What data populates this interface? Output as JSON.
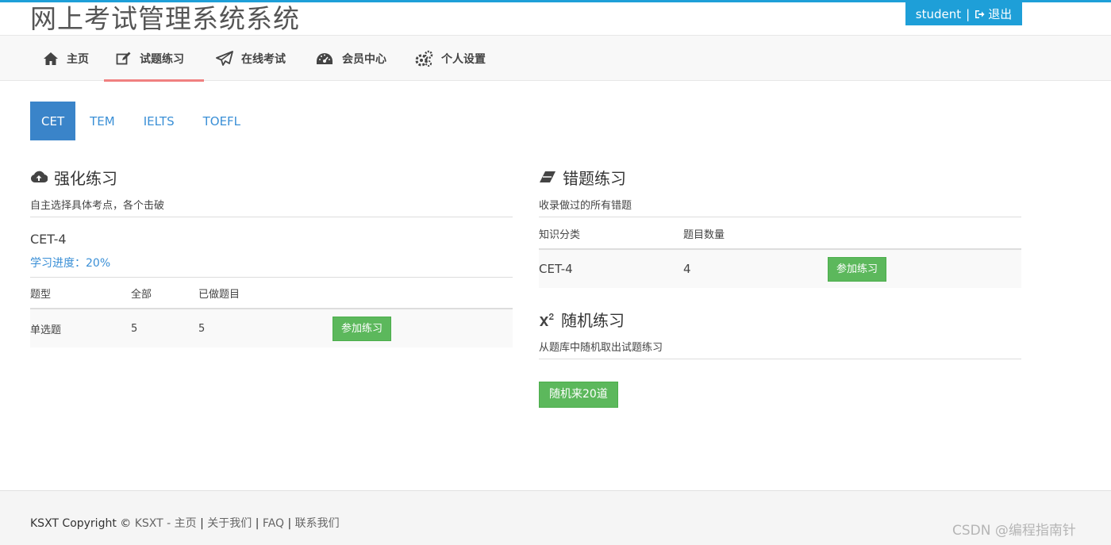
{
  "header": {
    "site_title": "网上考试管理系统系统",
    "username": "student",
    "separator": "|",
    "logout_label": "退出"
  },
  "nav": {
    "items": [
      {
        "label": "主页",
        "icon": "home-icon"
      },
      {
        "label": "试题练习",
        "icon": "edit-icon",
        "active": true
      },
      {
        "label": "在线考试",
        "icon": "paper-plane-icon"
      },
      {
        "label": "会员中心",
        "icon": "dashboard-icon"
      },
      {
        "label": "个人设置",
        "icon": "gears-icon"
      }
    ]
  },
  "tabs": [
    {
      "label": "CET",
      "active": true
    },
    {
      "label": "TEM"
    },
    {
      "label": "IELTS"
    },
    {
      "label": "TOEFL"
    }
  ],
  "intensive": {
    "title": "强化练习",
    "icon": "cloud-upload-icon",
    "desc": "自主选择具体考点，各个击破",
    "subject": "CET-4",
    "progress": "学习进度：20%",
    "progress_value": 0.2,
    "table": {
      "headers": [
        "题型",
        "全部",
        "已做题目",
        ""
      ],
      "rows": [
        {
          "type": "单选题",
          "total": "5",
          "done": "5",
          "action": "参加练习"
        }
      ]
    }
  },
  "wrong": {
    "title": "错题练习",
    "icon": "eraser-icon",
    "desc": "收录做过的所有错题",
    "table": {
      "headers": [
        "知识分类",
        "题目数量",
        ""
      ],
      "rows": [
        {
          "category": "CET-4",
          "count": "4",
          "action": "参加练习"
        }
      ]
    }
  },
  "random": {
    "title": "随机练习",
    "icon": "superscript-icon",
    "desc": "从题库中随机取出试题练习",
    "button": "随机来20道"
  },
  "footer": {
    "prefix": "KSXT Copyright © ",
    "brand": "KSXT",
    "links": [
      "- 主页",
      "关于我们",
      "FAQ",
      "联系我们"
    ],
    "separator": "|"
  },
  "watermark": "CSDN @编程指南针",
  "colors": {
    "accent_blue": "#1e9fd8",
    "tab_active": "#3a84c9",
    "link_blue": "#3a8fd6",
    "button_green": "#5cb85c",
    "nav_active_underline": "#f08080"
  }
}
